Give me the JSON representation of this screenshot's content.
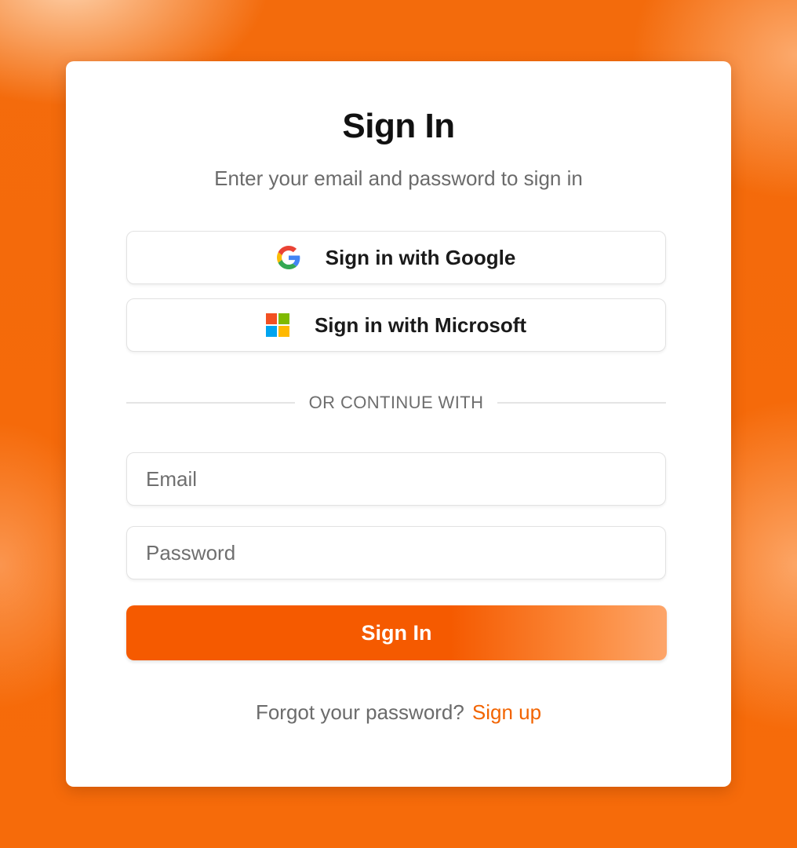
{
  "card": {
    "title": "Sign In",
    "subtitle": "Enter your email and password to sign in"
  },
  "oauth": {
    "google_label": "Sign in with Google",
    "microsoft_label": "Sign in with Microsoft",
    "google_icon": "google-logo-icon",
    "microsoft_icon": "microsoft-logo-icon"
  },
  "divider": {
    "text": "OR CONTINUE WITH"
  },
  "form": {
    "email_placeholder": "Email",
    "email_value": "",
    "password_placeholder": "Password",
    "password_value": "",
    "submit_label": "Sign In"
  },
  "footer": {
    "forgot_text": "Forgot your password?",
    "signup_text": "Sign up"
  },
  "colors": {
    "accent": "#f55a00",
    "link": "#f26400",
    "background": "#f56a0a"
  }
}
